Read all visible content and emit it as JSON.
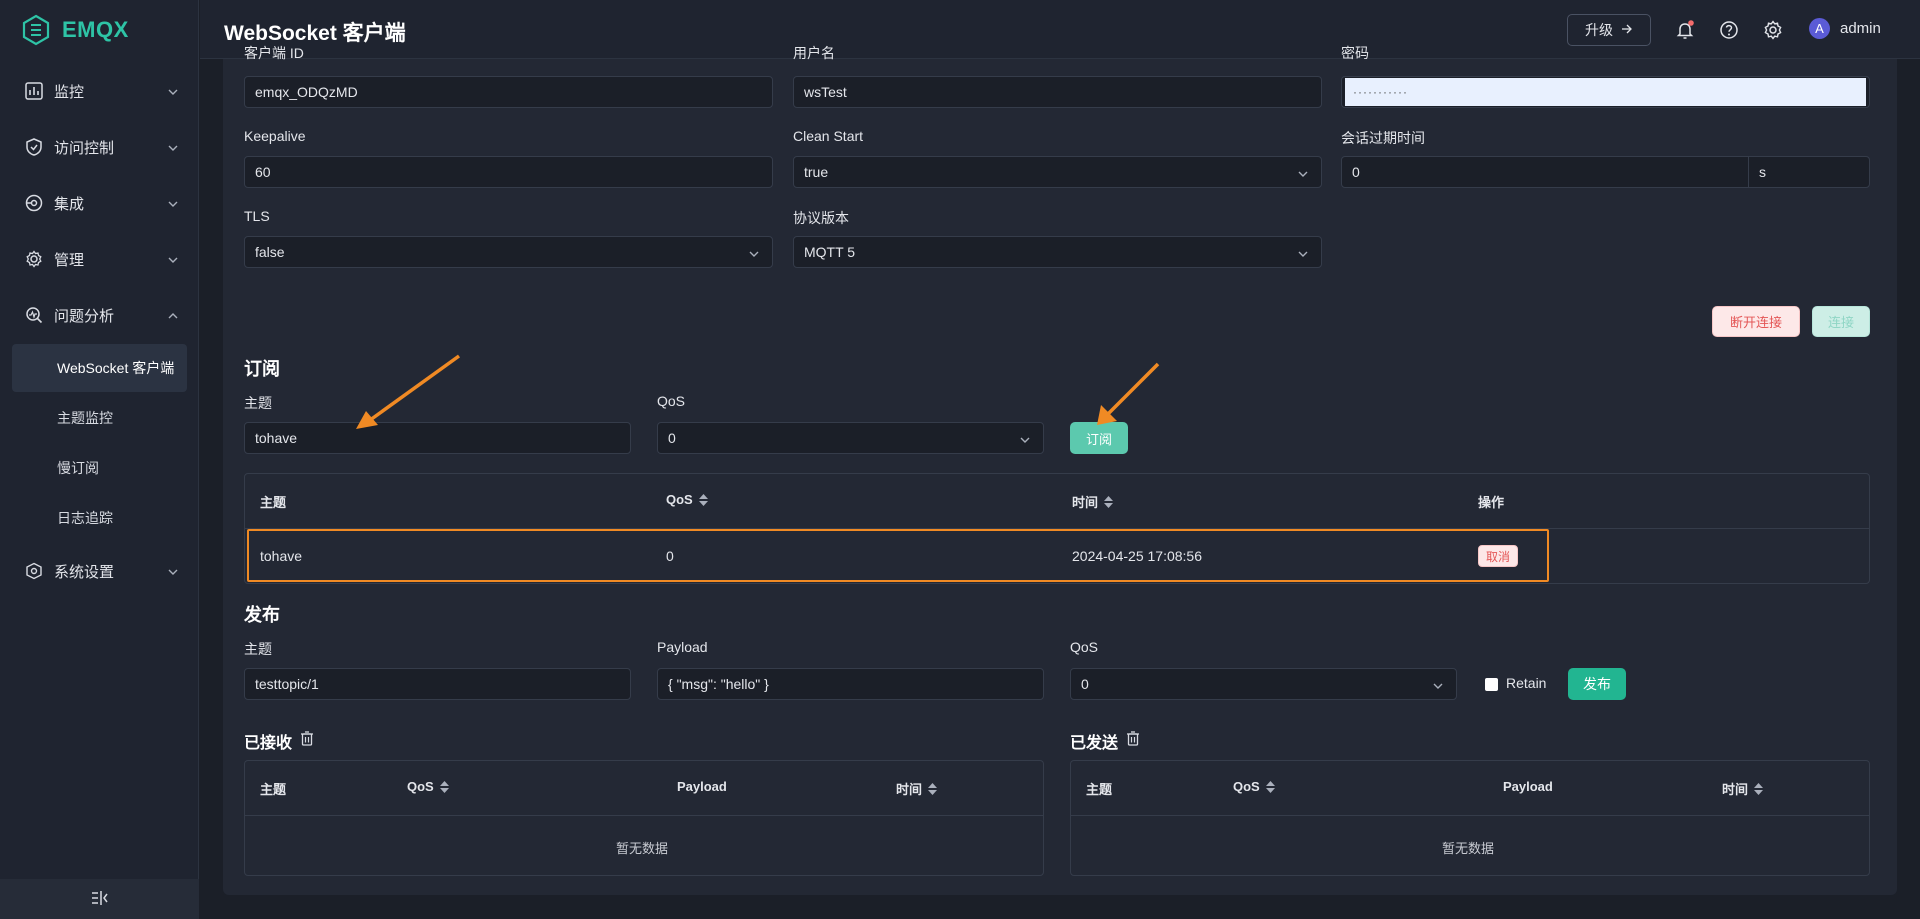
{
  "app": {
    "brand": "EMQX",
    "page_title": "WebSocket 客户端"
  },
  "sidebar": {
    "items": [
      {
        "label": "监控",
        "icon": "chart-bars-icon"
      },
      {
        "label": "访问控制",
        "icon": "shield-icon"
      },
      {
        "label": "集成",
        "icon": "integration-icon"
      },
      {
        "label": "管理",
        "icon": "gear-icon"
      },
      {
        "label": "问题分析",
        "icon": "diagnose-icon"
      }
    ],
    "sub_items": [
      {
        "label": "WebSocket 客户端",
        "active": true
      },
      {
        "label": "主题监控"
      },
      {
        "label": "慢订阅"
      },
      {
        "label": "日志追踪"
      }
    ],
    "settings": {
      "label": "系统设置",
      "icon": "settings-cube-icon"
    }
  },
  "header": {
    "upgrade_label": "升级",
    "username": "admin",
    "avatar_initial": "A"
  },
  "connection": {
    "client_id_label": "客户端 ID",
    "client_id": "emqx_ODQzMD",
    "username_label": "用户名",
    "username": "wsTest",
    "password_label": "密码",
    "password": "···········",
    "keepalive_label": "Keepalive",
    "keepalive": "60",
    "clean_start_label": "Clean Start",
    "clean_start": "true",
    "session_expiry_label": "会话过期时间",
    "session_expiry": "0",
    "session_expiry_unit": "s",
    "tls_label": "TLS",
    "tls": "false",
    "protocol_label": "协议版本",
    "protocol": "MQTT 5",
    "disconnect_label": "断开连接",
    "connect_label": "连接"
  },
  "subscribe": {
    "title": "订阅",
    "topic_label": "主题",
    "topic": "tohave",
    "qos_label": "QoS",
    "qos": "0",
    "subscribe_label": "订阅",
    "columns": [
      "主题",
      "QoS",
      "时间",
      "操作"
    ],
    "rows": [
      {
        "topic": "tohave",
        "qos": "0",
        "time": "2024-04-25 17:08:56",
        "action": "取消"
      }
    ]
  },
  "publish": {
    "title": "发布",
    "topic_label": "主题",
    "topic": "testtopic/1",
    "payload_label": "Payload",
    "payload": "{ \"msg\": \"hello\" }",
    "qos_label": "QoS",
    "qos": "0",
    "retain_label": "Retain",
    "publish_label": "发布"
  },
  "received": {
    "title": "已接收",
    "columns": [
      "主题",
      "QoS",
      "Payload",
      "时间"
    ],
    "empty": "暂无数据"
  },
  "sent": {
    "title": "已发送",
    "columns": [
      "主题",
      "QoS",
      "Payload",
      "时间"
    ],
    "empty": "暂无数据"
  },
  "colors": {
    "accent": "#2ec4a6",
    "highlight": "#f08a24",
    "danger": "#e45656"
  }
}
